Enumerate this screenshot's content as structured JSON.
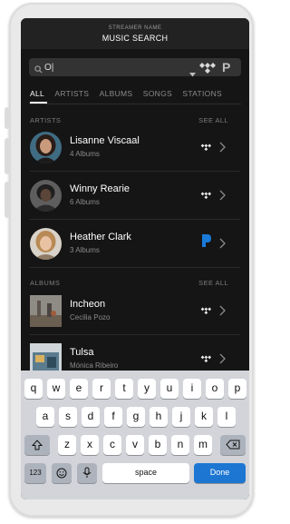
{
  "header": {
    "subtitle": "STREAMER NAME",
    "title": "MUSIC SEARCH"
  },
  "search": {
    "query": "O|",
    "service_badge": "P"
  },
  "tabs": [
    {
      "label": "ALL",
      "active": true
    },
    {
      "label": "ARTISTS"
    },
    {
      "label": "ALBUMS"
    },
    {
      "label": "SONGS"
    },
    {
      "label": "STATIONS"
    }
  ],
  "artists_section": {
    "label": "ARTISTS",
    "see_all": "SEE ALL"
  },
  "artists": [
    {
      "name": "Lisanne Viscaal",
      "meta": "4 Albums",
      "service": "tidal-icon"
    },
    {
      "name": "Winny Rearie",
      "meta": "6 Albums",
      "service": "tidal-icon"
    },
    {
      "name": "Heather Clark",
      "meta": "3 Albums",
      "service": "pandora-icon"
    }
  ],
  "albums_section": {
    "label": "ALBUMS",
    "see_all": "SEE ALL"
  },
  "albums": [
    {
      "name": "Incheon",
      "meta": "Cecilia Pozo",
      "service": "tidal-icon"
    },
    {
      "name": "Tulsa",
      "meta": "Mónica Ribeiro",
      "service": "tidal-icon"
    }
  ],
  "keyboard": {
    "row1": [
      "q",
      "w",
      "e",
      "r",
      "t",
      "y",
      "u",
      "i",
      "o",
      "p"
    ],
    "row2": [
      "a",
      "s",
      "d",
      "f",
      "g",
      "h",
      "j",
      "k",
      "l"
    ],
    "row3": [
      "z",
      "x",
      "c",
      "v",
      "b",
      "n",
      "m"
    ],
    "numbers_label": "123",
    "space_label": "space",
    "done_label": "Done"
  },
  "colors": {
    "screen_bg": "#151515",
    "header_bg": "#222222",
    "accent_blue": "#1c76d2",
    "pandora_blue": "#1a7ad9",
    "keyboard_bg": "#d2d4d9"
  }
}
